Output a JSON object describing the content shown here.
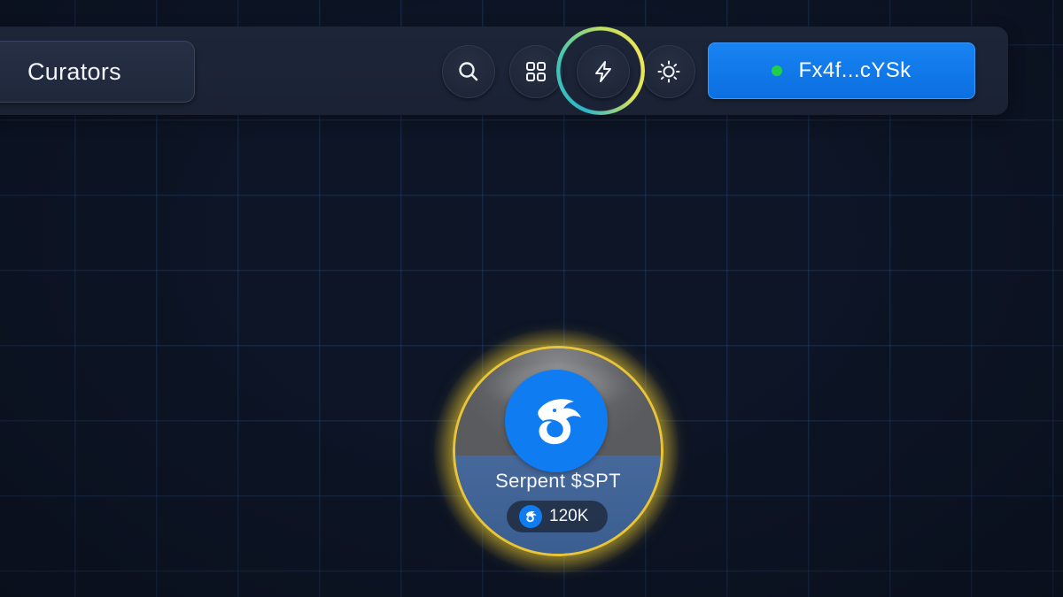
{
  "header": {
    "section_title": "Curators",
    "icons": {
      "search": "search-icon",
      "grid": "grid-icon",
      "bolt": "lightning-bolt-icon",
      "theme": "sun-icon"
    },
    "wallet": {
      "address": "Fx4f...cYSk",
      "status": "connected",
      "status_color": "#1fd14a",
      "button_color": "#0f7cf2"
    },
    "active_icon": "lightning-bolt-icon"
  },
  "canvas": {
    "background": "grid",
    "tokens": [
      {
        "name": "Serpent $SPT",
        "value": "120K",
        "logo": "serpent-dragon-icon",
        "highlight_color": "#e8c43a"
      }
    ]
  },
  "colors": {
    "background": "#0d1526",
    "bar": "#1d2639",
    "accent_blue": "#0f7cf2",
    "ring_gradient": [
      "#2fb6c8",
      "#f1e65a"
    ]
  }
}
